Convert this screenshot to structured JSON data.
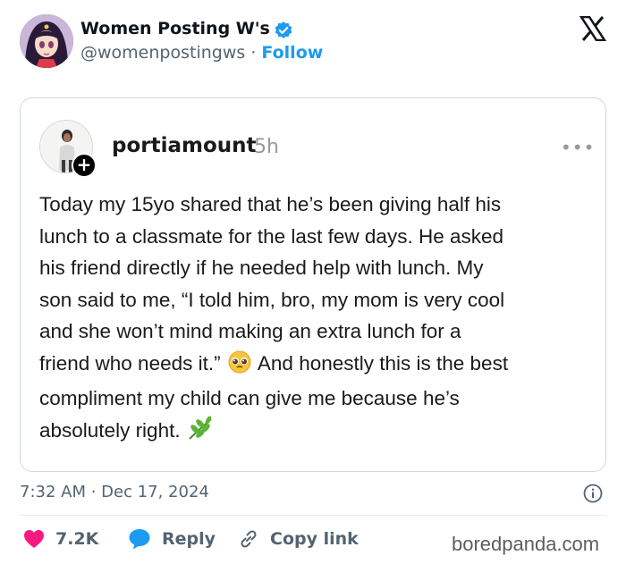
{
  "author": {
    "display_name": "Women Posting W's",
    "handle": "@womenpostingws",
    "separator": "·",
    "follow_label": "Follow"
  },
  "quoted_post": {
    "username": "portiamount",
    "time_ago": "5h",
    "more_label": "•••",
    "plus_label": "+",
    "text_lines": [
      "Today my 15yo shared that he’s been giving half his",
      "lunch to a classmate for the last few days. He asked",
      "his friend directly if he needed help with lunch. My",
      "son said to me, “I told him, bro, my mom is very cool",
      "and she won’t mind making an extra lunch for a",
      "friend who needs it.”",
      "And honestly this is the best",
      "compliment my child can give me because he’s",
      "absolutely right."
    ]
  },
  "meta": {
    "timestamp": "7:32 AM · Dec 17, 2024"
  },
  "actions": {
    "likes": "7.2K",
    "reply_label": "Reply",
    "copy_label": "Copy link"
  },
  "watermark": "boredpanda.com",
  "colors": {
    "accent": "#1d9bf0",
    "like": "#f91880",
    "muted": "#536471"
  },
  "icons": [
    "verified-badge-icon",
    "x-logo-icon",
    "plus-icon",
    "more-icon",
    "pleading-face-emoji",
    "herb-emoji",
    "info-icon",
    "heart-icon",
    "reply-bubble-icon",
    "link-icon"
  ]
}
